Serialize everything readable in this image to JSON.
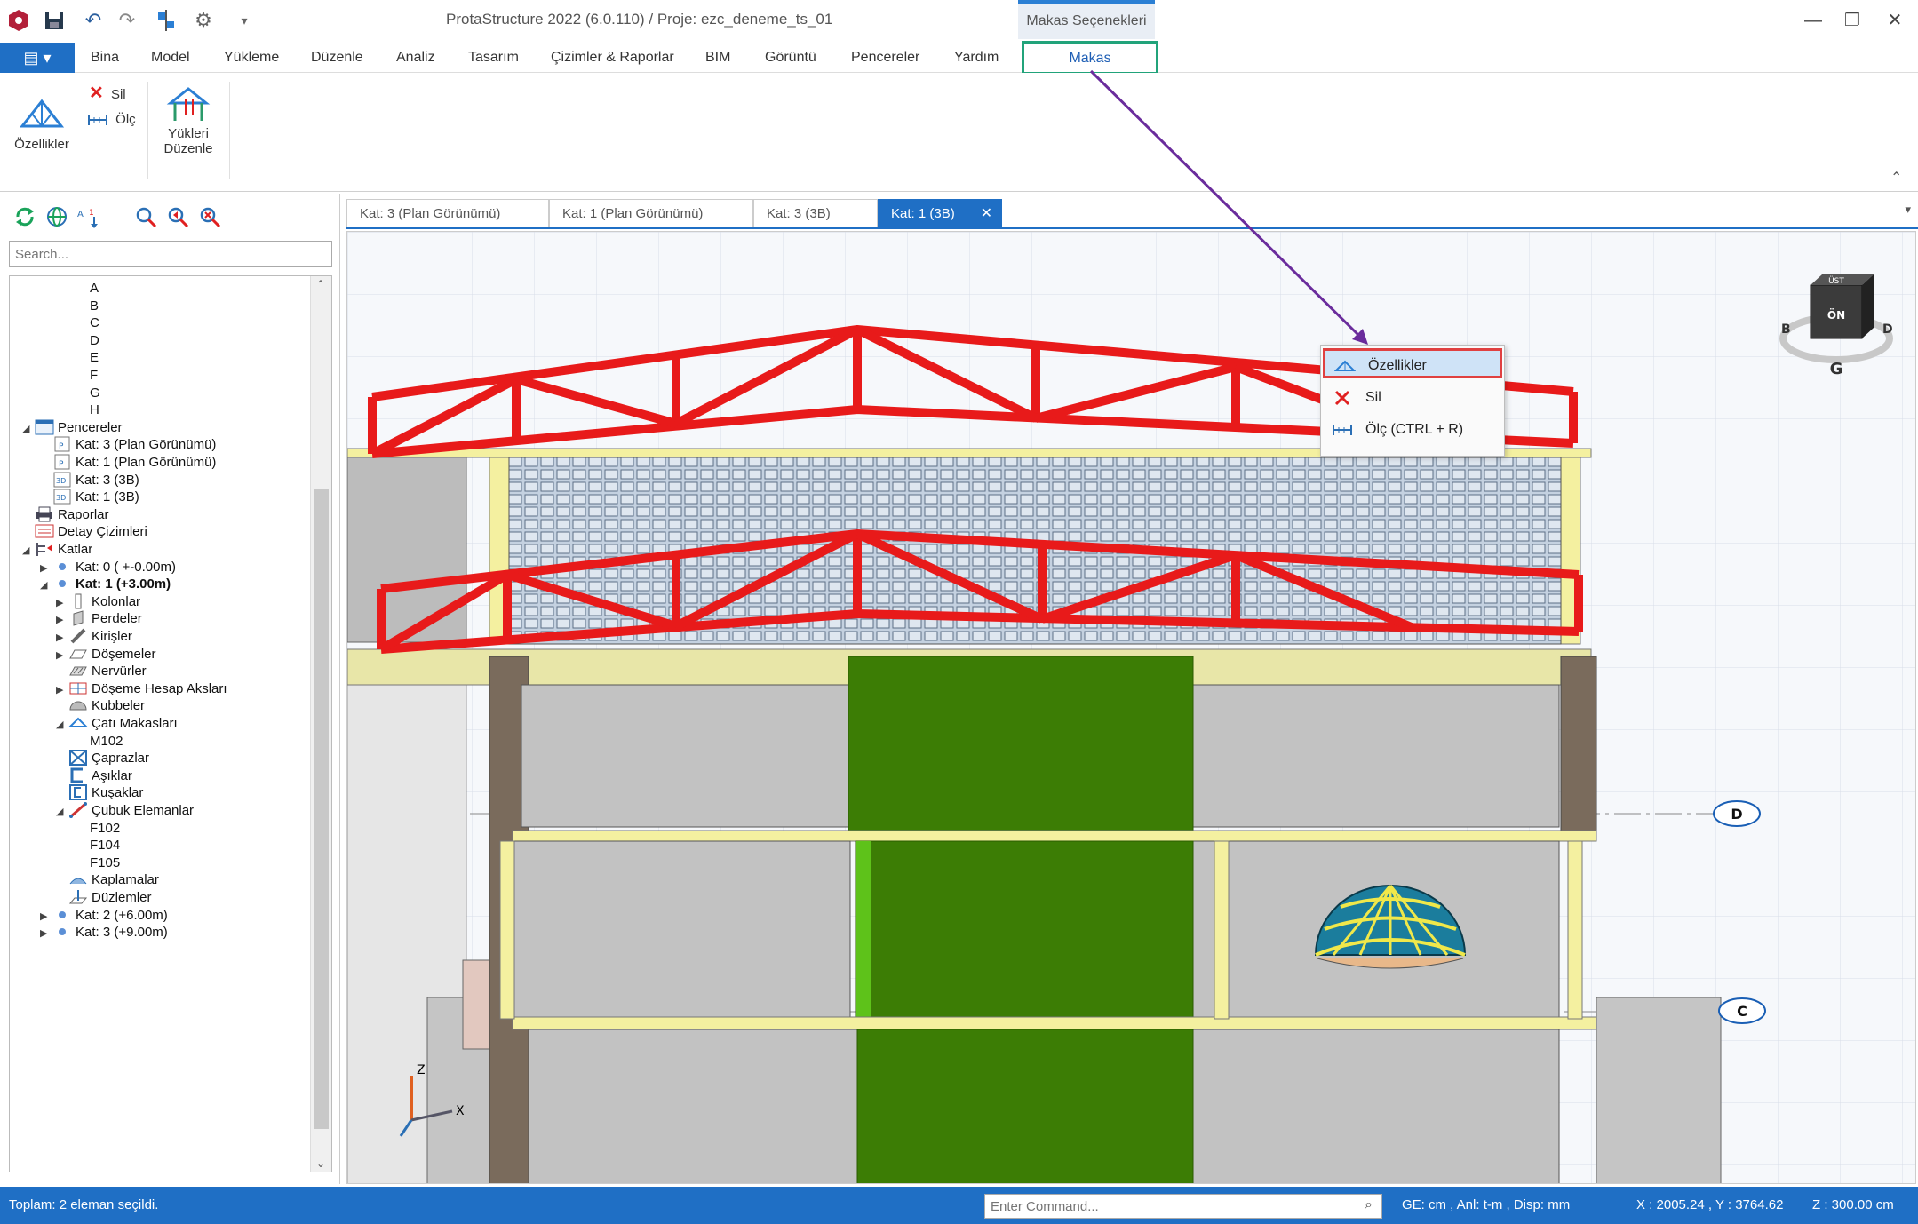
{
  "window": {
    "title": "ProtaStructure 2022 (6.0.110) / Proje: ezc_deneme_ts_01",
    "context_title": "Makas Seçenekleri"
  },
  "ribbon_tabs": [
    "Bina",
    "Model",
    "Yükleme",
    "Düzenle",
    "Analiz",
    "Tasarım",
    "Çizimler & Raporlar",
    "BIM",
    "Görüntü",
    "Pencereler",
    "Yardım",
    "Makas"
  ],
  "ribbon": {
    "ozellikler": "Özellikler",
    "sil": "Sil",
    "olc": "Ölç",
    "yukleri": "Yükleri",
    "duzenle": "Düzenle"
  },
  "left_panel": {
    "search_placeholder": "Search..."
  },
  "tree": [
    {
      "label": "A",
      "level": 4
    },
    {
      "label": "B",
      "level": 4
    },
    {
      "label": "C",
      "level": 4
    },
    {
      "label": "D",
      "level": 4
    },
    {
      "label": "E",
      "level": 4
    },
    {
      "label": "F",
      "level": 4
    },
    {
      "label": "G",
      "level": 4
    },
    {
      "label": "H",
      "level": 4
    },
    {
      "label": "Pencereler",
      "level": 1,
      "exp": "◢",
      "icon": "windows"
    },
    {
      "label": "Kat: 3 (Plan Görünümü)",
      "level": 2,
      "icon": "plan"
    },
    {
      "label": "Kat: 1 (Plan Görünümü)",
      "level": 2,
      "icon": "plan"
    },
    {
      "label": "Kat: 3 (3B)",
      "level": 2,
      "icon": "3d"
    },
    {
      "label": "Kat: 1 (3B)",
      "level": 2,
      "icon": "3d"
    },
    {
      "label": "Raporlar",
      "level": 1,
      "icon": "printer"
    },
    {
      "label": "Detay Çizimleri",
      "level": 1,
      "icon": "drawing"
    },
    {
      "label": "Katlar",
      "level": 1,
      "exp": "◢",
      "icon": "floors"
    },
    {
      "label": "Kat: 0 ( +-0.00m)",
      "level": 2,
      "exp": "▶",
      "icon": "dot"
    },
    {
      "label": "Kat: 1 (+3.00m)",
      "level": 2,
      "exp": "◢",
      "icon": "dot",
      "bold": true
    },
    {
      "label": "Kolonlar",
      "level": 3,
      "exp": "▶",
      "icon": "column"
    },
    {
      "label": "Perdeler",
      "level": 3,
      "exp": "▶",
      "icon": "wall"
    },
    {
      "label": "Kirişler",
      "level": 3,
      "exp": "▶",
      "icon": "beam"
    },
    {
      "label": "Döşemeler",
      "level": 3,
      "exp": "▶",
      "icon": "slab"
    },
    {
      "label": "Nervürler",
      "level": 3,
      "icon": "rib"
    },
    {
      "label": "Döşeme Hesap Aksları",
      "level": 3,
      "exp": "▶",
      "icon": "axes"
    },
    {
      "label": "Kubbeler",
      "level": 3,
      "icon": "dome"
    },
    {
      "label": "Çatı Makasları",
      "level": 3,
      "exp": "◢",
      "icon": "truss"
    },
    {
      "label": "M102",
      "level": 4
    },
    {
      "label": "Çaprazlar",
      "level": 3,
      "icon": "brace"
    },
    {
      "label": "Aşıklar",
      "level": 3,
      "icon": "purlin"
    },
    {
      "label": "Kuşaklar",
      "level": 3,
      "icon": "girt"
    },
    {
      "label": "Çubuk Elemanlar",
      "level": 3,
      "exp": "◢",
      "icon": "member"
    },
    {
      "label": "F102",
      "level": 4
    },
    {
      "label": "F104",
      "level": 4
    },
    {
      "label": "F105",
      "level": 4
    },
    {
      "label": "Kaplamalar",
      "level": 3,
      "icon": "cladding"
    },
    {
      "label": "Düzlemler",
      "level": 3,
      "icon": "plane"
    },
    {
      "label": "Kat: 2 (+6.00m)",
      "level": 2,
      "exp": "▶",
      "icon": "dot"
    },
    {
      "label": "Kat: 3 (+9.00m)",
      "level": 2,
      "exp": "▶",
      "icon": "dot"
    }
  ],
  "doc_tabs": [
    "Kat: 3 (Plan Görünümü)",
    "Kat: 1 (Plan Görünümü)",
    "Kat: 3 (3B)",
    "Kat: 1 (3B)"
  ],
  "active_doc_tab": 3,
  "context_menu": [
    {
      "label": "Özellikler",
      "icon": "truss-icon"
    },
    {
      "label": "Sil",
      "icon": "delete-icon"
    },
    {
      "label": "Ölç (CTRL + R)",
      "icon": "measure-icon"
    }
  ],
  "viewcube": {
    "top": "ÜST",
    "front": "ÖN",
    "left": "B",
    "right": "D",
    "bottom": "G"
  },
  "axis_bubbles": [
    "D",
    "C"
  ],
  "axis_tripod": {
    "z": "Z",
    "x": "X"
  },
  "status": {
    "selection": "Toplam: 2 eleman seçildi.",
    "command_placeholder": "Enter Command...",
    "units": "GE: cm , Anl: t-m , Disp: mm",
    "coords": "X : 2005.24 , Y : 3764.62",
    "z": "Z : 300.00 cm"
  },
  "colors": {
    "accent": "#1f6fc5",
    "truss": "#e81a1a",
    "highlight": "#21a37a",
    "menu_border": "#e04040",
    "arrow": "#6a2c9c"
  }
}
